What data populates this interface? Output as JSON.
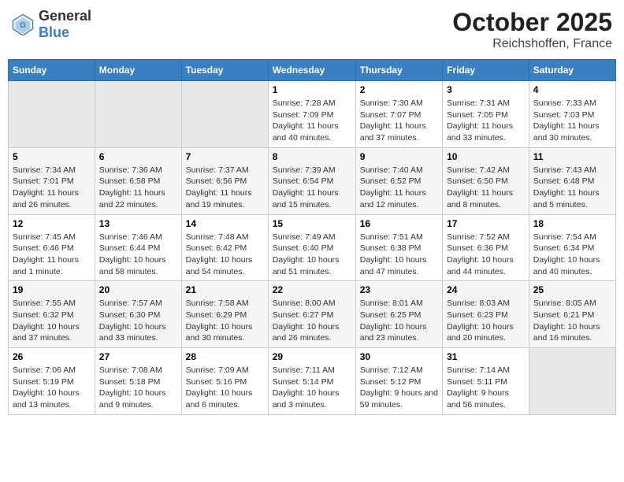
{
  "header": {
    "logo_general": "General",
    "logo_blue": "Blue",
    "month": "October 2025",
    "location": "Reichshoffen, France"
  },
  "weekdays": [
    "Sunday",
    "Monday",
    "Tuesday",
    "Wednesday",
    "Thursday",
    "Friday",
    "Saturday"
  ],
  "weeks": [
    [
      {
        "day": "",
        "info": ""
      },
      {
        "day": "",
        "info": ""
      },
      {
        "day": "",
        "info": ""
      },
      {
        "day": "1",
        "info": "Sunrise: 7:28 AM\nSunset: 7:09 PM\nDaylight: 11 hours and 40 minutes."
      },
      {
        "day": "2",
        "info": "Sunrise: 7:30 AM\nSunset: 7:07 PM\nDaylight: 11 hours and 37 minutes."
      },
      {
        "day": "3",
        "info": "Sunrise: 7:31 AM\nSunset: 7:05 PM\nDaylight: 11 hours and 33 minutes."
      },
      {
        "day": "4",
        "info": "Sunrise: 7:33 AM\nSunset: 7:03 PM\nDaylight: 11 hours and 30 minutes."
      }
    ],
    [
      {
        "day": "5",
        "info": "Sunrise: 7:34 AM\nSunset: 7:01 PM\nDaylight: 11 hours and 26 minutes."
      },
      {
        "day": "6",
        "info": "Sunrise: 7:36 AM\nSunset: 6:58 PM\nDaylight: 11 hours and 22 minutes."
      },
      {
        "day": "7",
        "info": "Sunrise: 7:37 AM\nSunset: 6:56 PM\nDaylight: 11 hours and 19 minutes."
      },
      {
        "day": "8",
        "info": "Sunrise: 7:39 AM\nSunset: 6:54 PM\nDaylight: 11 hours and 15 minutes."
      },
      {
        "day": "9",
        "info": "Sunrise: 7:40 AM\nSunset: 6:52 PM\nDaylight: 11 hours and 12 minutes."
      },
      {
        "day": "10",
        "info": "Sunrise: 7:42 AM\nSunset: 6:50 PM\nDaylight: 11 hours and 8 minutes."
      },
      {
        "day": "11",
        "info": "Sunrise: 7:43 AM\nSunset: 6:48 PM\nDaylight: 11 hours and 5 minutes."
      }
    ],
    [
      {
        "day": "12",
        "info": "Sunrise: 7:45 AM\nSunset: 6:46 PM\nDaylight: 11 hours and 1 minute."
      },
      {
        "day": "13",
        "info": "Sunrise: 7:46 AM\nSunset: 6:44 PM\nDaylight: 10 hours and 58 minutes."
      },
      {
        "day": "14",
        "info": "Sunrise: 7:48 AM\nSunset: 6:42 PM\nDaylight: 10 hours and 54 minutes."
      },
      {
        "day": "15",
        "info": "Sunrise: 7:49 AM\nSunset: 6:40 PM\nDaylight: 10 hours and 51 minutes."
      },
      {
        "day": "16",
        "info": "Sunrise: 7:51 AM\nSunset: 6:38 PM\nDaylight: 10 hours and 47 minutes."
      },
      {
        "day": "17",
        "info": "Sunrise: 7:52 AM\nSunset: 6:36 PM\nDaylight: 10 hours and 44 minutes."
      },
      {
        "day": "18",
        "info": "Sunrise: 7:54 AM\nSunset: 6:34 PM\nDaylight: 10 hours and 40 minutes."
      }
    ],
    [
      {
        "day": "19",
        "info": "Sunrise: 7:55 AM\nSunset: 6:32 PM\nDaylight: 10 hours and 37 minutes."
      },
      {
        "day": "20",
        "info": "Sunrise: 7:57 AM\nSunset: 6:30 PM\nDaylight: 10 hours and 33 minutes."
      },
      {
        "day": "21",
        "info": "Sunrise: 7:58 AM\nSunset: 6:29 PM\nDaylight: 10 hours and 30 minutes."
      },
      {
        "day": "22",
        "info": "Sunrise: 8:00 AM\nSunset: 6:27 PM\nDaylight: 10 hours and 26 minutes."
      },
      {
        "day": "23",
        "info": "Sunrise: 8:01 AM\nSunset: 6:25 PM\nDaylight: 10 hours and 23 minutes."
      },
      {
        "day": "24",
        "info": "Sunrise: 8:03 AM\nSunset: 6:23 PM\nDaylight: 10 hours and 20 minutes."
      },
      {
        "day": "25",
        "info": "Sunrise: 8:05 AM\nSunset: 6:21 PM\nDaylight: 10 hours and 16 minutes."
      }
    ],
    [
      {
        "day": "26",
        "info": "Sunrise: 7:06 AM\nSunset: 5:19 PM\nDaylight: 10 hours and 13 minutes."
      },
      {
        "day": "27",
        "info": "Sunrise: 7:08 AM\nSunset: 5:18 PM\nDaylight: 10 hours and 9 minutes."
      },
      {
        "day": "28",
        "info": "Sunrise: 7:09 AM\nSunset: 5:16 PM\nDaylight: 10 hours and 6 minutes."
      },
      {
        "day": "29",
        "info": "Sunrise: 7:11 AM\nSunset: 5:14 PM\nDaylight: 10 hours and 3 minutes."
      },
      {
        "day": "30",
        "info": "Sunrise: 7:12 AM\nSunset: 5:12 PM\nDaylight: 9 hours and 59 minutes."
      },
      {
        "day": "31",
        "info": "Sunrise: 7:14 AM\nSunset: 5:11 PM\nDaylight: 9 hours and 56 minutes."
      },
      {
        "day": "",
        "info": ""
      }
    ]
  ]
}
